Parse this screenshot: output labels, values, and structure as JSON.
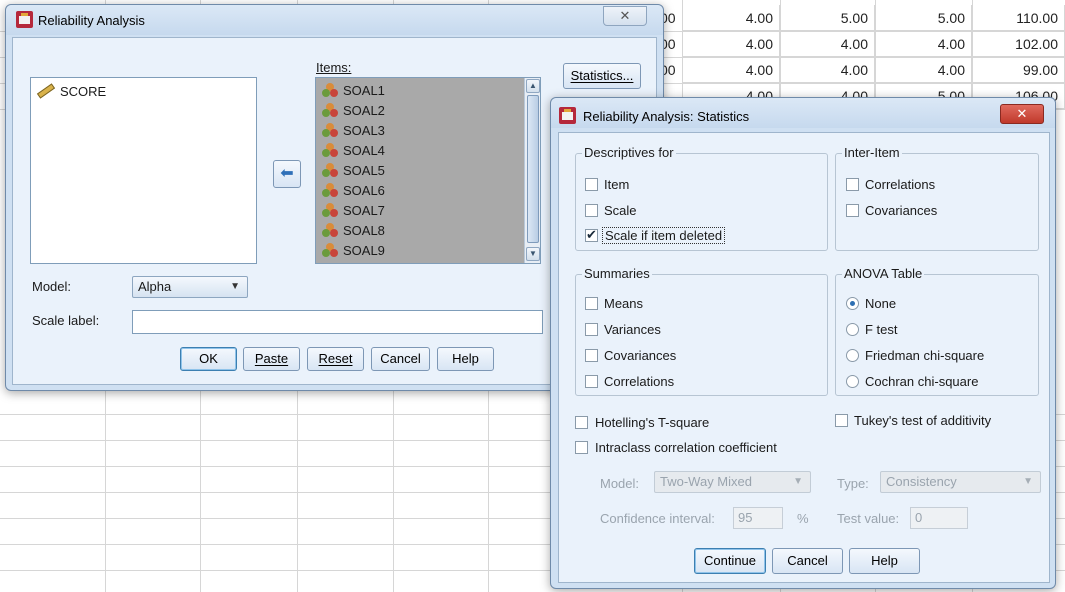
{
  "grid": {
    "row1": [
      "00",
      "4.00",
      "5.00",
      "5.00",
      "110.00"
    ],
    "row2": [
      "00",
      "4.00",
      "4.00",
      "4.00",
      "102.00"
    ],
    "row3": [
      "00",
      "4.00",
      "4.00",
      "4.00",
      "99.00"
    ],
    "row4_partial": [
      "4.00",
      "4.00",
      "5.00",
      "106.00"
    ]
  },
  "main_dialog": {
    "title": "Reliability Analysis",
    "variables": [
      "SCORE"
    ],
    "items_label": "Items:",
    "items": [
      "SOAL1",
      "SOAL2",
      "SOAL3",
      "SOAL4",
      "SOAL5",
      "SOAL6",
      "SOAL7",
      "SOAL8",
      "SOAL9"
    ],
    "statistics_button": "Statistics...",
    "model_label": "Model:",
    "model_value": "Alpha",
    "scale_label": "Scale label:",
    "scale_value": "",
    "buttons": {
      "ok": "OK",
      "paste": "Paste",
      "reset": "Reset",
      "cancel": "Cancel",
      "help": "Help"
    },
    "close_glyph": "✕"
  },
  "stats_dialog": {
    "title": "Reliability Analysis: Statistics",
    "close_glyph": "✕",
    "descriptives": {
      "title": "Descriptives for",
      "item": "Item",
      "scale": "Scale",
      "scale_if_deleted": "Scale if item deleted"
    },
    "inter_item": {
      "title": "Inter-Item",
      "correlations": "Correlations",
      "covariances": "Covariances"
    },
    "summaries": {
      "title": "Summaries",
      "means": "Means",
      "variances": "Variances",
      "covariances": "Covariances",
      "correlations": "Correlations"
    },
    "anova": {
      "title": "ANOVA Table",
      "none": "None",
      "f_test": "F test",
      "friedman": "Friedman chi-square",
      "cochran": "Cochran chi-square"
    },
    "hotelling": "Hotelling's T-square",
    "tukey": "Tukey's test of additivity",
    "icc": "Intraclass correlation coefficient",
    "model_label": "Model:",
    "model_value": "Two-Way Mixed",
    "type_label": "Type:",
    "type_value": "Consistency",
    "ci_label": "Confidence interval:",
    "ci_value": "95",
    "percent": "%",
    "test_value_label": "Test value:",
    "test_value": "0",
    "buttons": {
      "continue": "Continue",
      "cancel": "Cancel",
      "help": "Help"
    }
  },
  "state": {
    "scale_if_item_deleted": true,
    "anova_selected": "None"
  },
  "colors": {
    "dialog_frame": "#cfe0f2",
    "client_bg": "#eaf2fb",
    "close_button_red": "#c8453a",
    "selected_items_bg": "#a9a9a9"
  }
}
